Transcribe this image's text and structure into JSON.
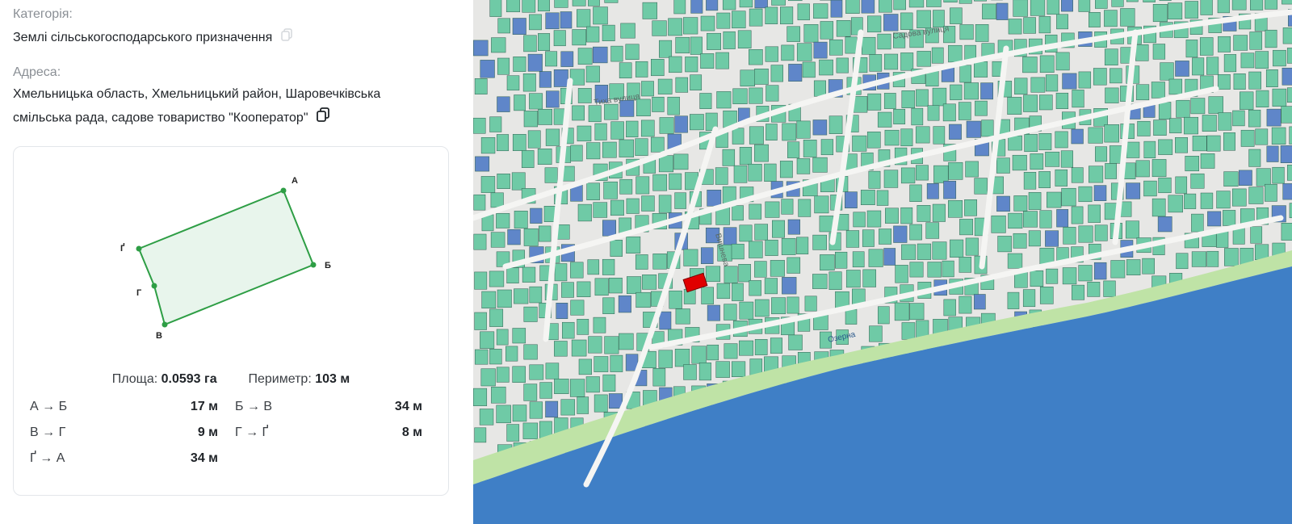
{
  "info": {
    "category_label": "Категорія:",
    "category_value": "Землі сільськогосподарського призначення",
    "address_label": "Адреса:",
    "address_line1": "Хмельницька область, Хмельницький район, Шаровечківська",
    "address_line2": "смільська рада, садове товариство \"Кооператор\""
  },
  "parcel": {
    "vertices": {
      "a": "А",
      "b": "Б",
      "v": "В",
      "g": "Г",
      "gg": "Ґ"
    },
    "area_label": "Площа:",
    "area_value": "0.0593 га",
    "perimeter_label": "Периметр:",
    "perimeter_value": "103 м",
    "segments": [
      {
        "label": "А → Б",
        "value": "17 м"
      },
      {
        "label": "Б → В",
        "value": "34 м"
      },
      {
        "label": "В → Г",
        "value": "9 м"
      },
      {
        "label": "Г → Ґ",
        "value": "8 м"
      },
      {
        "label": "Ґ → А",
        "value": "34 м"
      }
    ],
    "fill_color": "#e8f5ec",
    "stroke_color": "#2e9e45"
  },
  "map": {
    "water_color": "#3f7fc6",
    "parcel_color": "#6fcaa6",
    "state_parcel_color": "#5f86c9",
    "selected_parcel_color": "#e00000",
    "street_labels": [
      "Садова вулиця",
      "Тиха вулиця",
      "Озерна",
      "Вишнева"
    ]
  }
}
